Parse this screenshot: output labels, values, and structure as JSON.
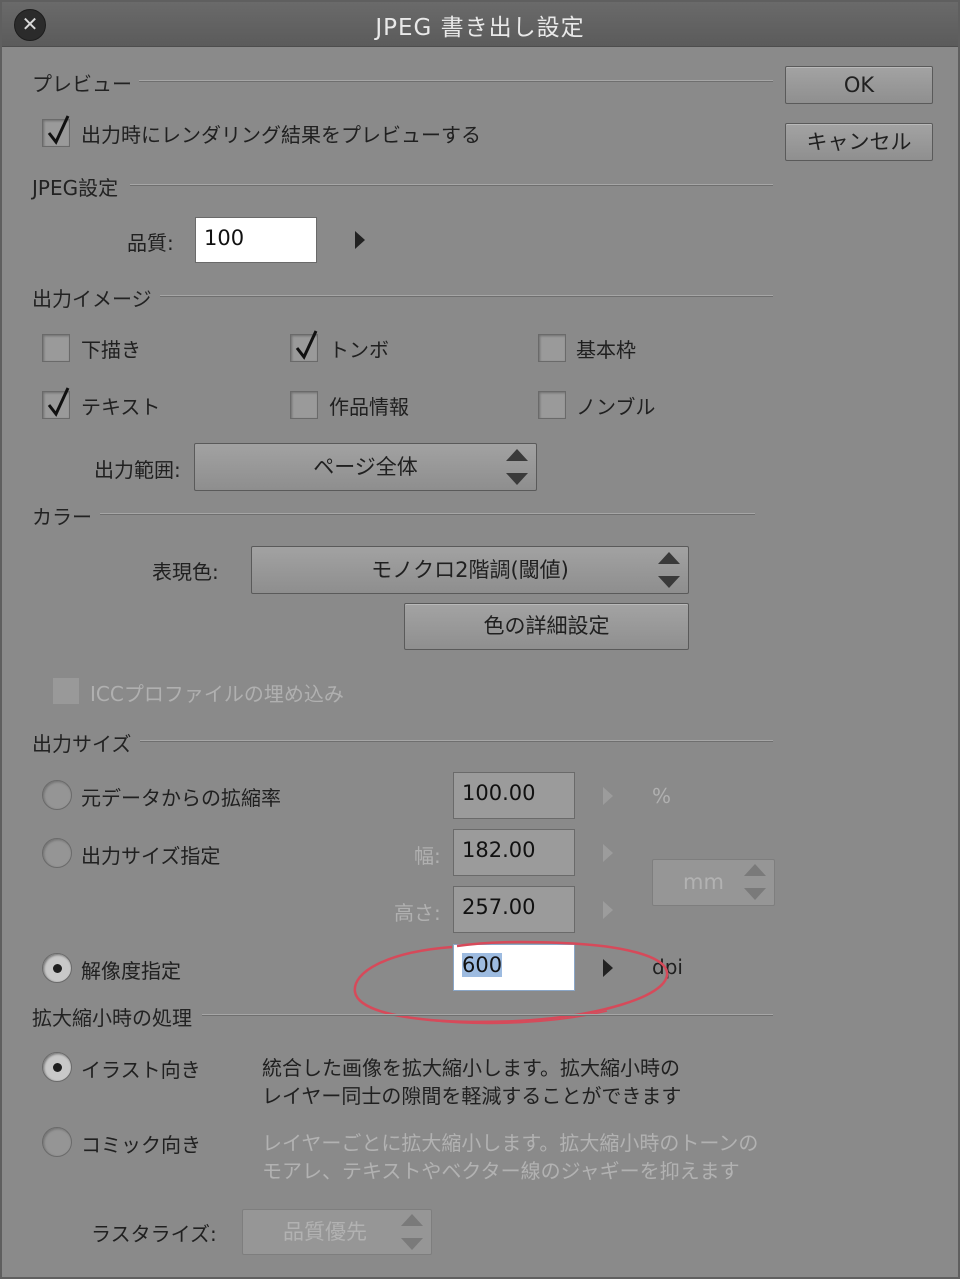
{
  "window": {
    "title": "JPEG 書き出し設定",
    "close_glyph": "✕"
  },
  "buttons": {
    "ok": "OK",
    "cancel": "キャンセル"
  },
  "preview": {
    "section": "プレビュー",
    "render_preview": {
      "label": "出力時にレンダリング結果をプレビューする",
      "checked": true
    }
  },
  "jpeg": {
    "section": "JPEG設定",
    "quality_label": "品質:",
    "quality_value": "100"
  },
  "output_image": {
    "section": "出力イメージ",
    "checkboxes": [
      {
        "label": "下描き",
        "checked": false
      },
      {
        "label": "トンボ",
        "checked": true
      },
      {
        "label": "基本枠",
        "checked": false
      },
      {
        "label": "テキスト",
        "checked": true
      },
      {
        "label": "作品情報",
        "checked": false
      },
      {
        "label": "ノンブル",
        "checked": false
      }
    ],
    "range_label": "出力範囲:",
    "range_value": "ページ全体"
  },
  "color": {
    "section": "カラー",
    "expression_label": "表現色:",
    "expression_value": "モノクロ2階調(閾値)",
    "detail_button": "色の詳細設定",
    "icc_label": "ICCプロファイルの埋め込み"
  },
  "output_size": {
    "section": "出力サイズ",
    "scale": {
      "label": "元データからの拡縮率",
      "value": "100.00",
      "unit": "%"
    },
    "size": {
      "label": "出力サイズ指定",
      "width_label": "幅:",
      "width_value": "182.00",
      "height_label": "高さ:",
      "height_value": "257.00",
      "unit": "mm"
    },
    "resolution": {
      "label": "解像度指定",
      "value": "600",
      "unit": "dpi",
      "selected": true
    }
  },
  "scaling": {
    "section": "拡大縮小時の処理",
    "illust": {
      "label": "イラスト向き",
      "desc1": "統合した画像を拡大縮小します。拡大縮小時の",
      "desc2": "レイヤー同士の隙間を軽減することができます"
    },
    "comic": {
      "label": "コミック向き",
      "desc1": "レイヤーごとに拡大縮小します。拡大縮小時のトーンの",
      "desc2": "モアレ、テキストやベクター線のジャギーを抑えます"
    },
    "rasterize_label": "ラスタライズ:",
    "rasterize_value": "品質優先"
  },
  "colors": {
    "annotation": "#d64a5a",
    "highlight": "#9dbbe0"
  }
}
